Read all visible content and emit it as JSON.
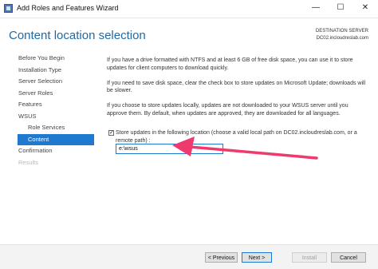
{
  "window": {
    "title": "Add Roles and Features Wizard",
    "minimize_glyph": "—",
    "maximize_glyph": "☐",
    "close_glyph": "✕"
  },
  "header": {
    "heading": "Content location selection",
    "destination_label": "DESTINATION SERVER",
    "destination_server": "DC02.incloudreslab.com"
  },
  "nav": {
    "items": [
      {
        "label": "Before You Begin"
      },
      {
        "label": "Installation Type"
      },
      {
        "label": "Server Selection"
      },
      {
        "label": "Server Roles"
      },
      {
        "label": "Features"
      },
      {
        "label": "WSUS"
      },
      {
        "label": "Role Services"
      },
      {
        "label": "Content"
      },
      {
        "label": "Confirmation"
      },
      {
        "label": "Results"
      }
    ]
  },
  "content": {
    "para1": "If you have a drive formatted with NTFS and at least 6 GB of free disk space, you can use it to store updates for client computers to download quickly.",
    "para2": "If you need to save disk space, clear the check box to store updates on Microsoft Update; downloads will be slower.",
    "para3": "If you choose to store updates locally, updates are not downloaded to your WSUS server until you approve them. By default, when updates are approved, they are downloaded for all languages.",
    "checkbox_label": "Store updates in the following location (choose a valid local path on DC02.incloudreslab.com, or a remote path) :",
    "checkbox_checked": true,
    "checkbox_glyph": "✓",
    "path_value": "e:\\wsus"
  },
  "annotation": {
    "arrow_color": "#ef3a6e"
  },
  "footer": {
    "previous": "< Previous",
    "next": "Next >",
    "install": "Install",
    "cancel": "Cancel"
  }
}
